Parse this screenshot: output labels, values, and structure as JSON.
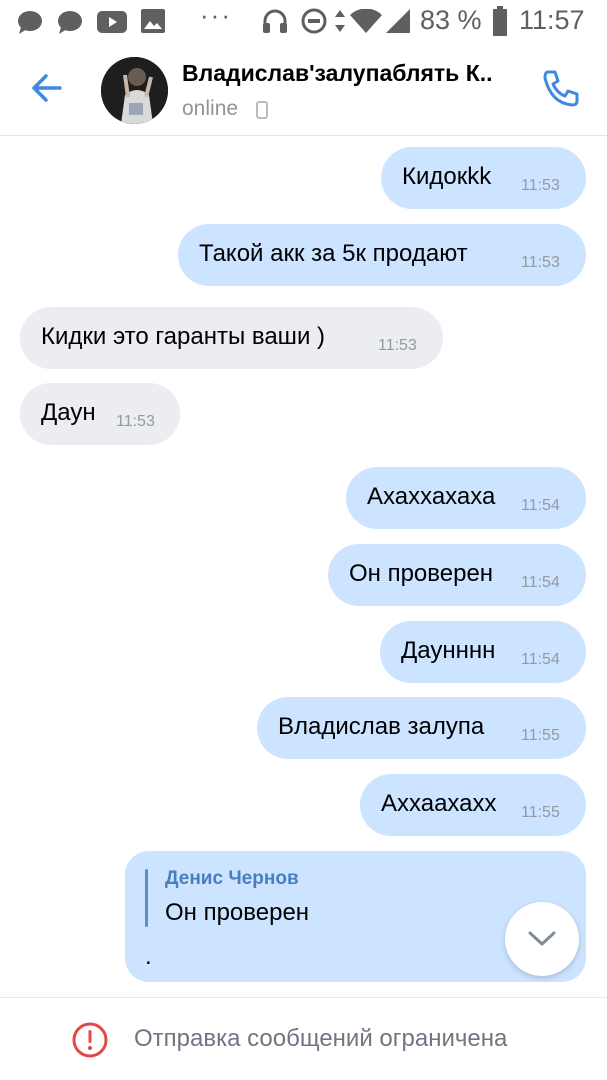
{
  "status_bar": {
    "dots": "···",
    "battery_percent": "83 %",
    "time": "11:57",
    "icons": [
      "chat-bubble-icon",
      "chat-bubble-icon",
      "youtube-icon",
      "image-icon",
      "headphones-icon",
      "dnd-icon",
      "data-arrows-icon",
      "wifi-icon",
      "signal-icon",
      "battery-icon"
    ]
  },
  "header": {
    "contact_name": "Владислав'залупаблять К..",
    "status": "online"
  },
  "messages": [
    {
      "text": "Кидокkk",
      "time": "11:53",
      "direction": "out"
    },
    {
      "text": "Такой акк за 5к продают",
      "time": "11:53",
      "direction": "out"
    },
    {
      "text": "Кидки это гаранты ваши )",
      "time": "11:53",
      "direction": "in"
    },
    {
      "text": "Даун",
      "time": "11:53",
      "direction": "in"
    },
    {
      "text": "Ахаххахаха",
      "time": "11:54",
      "direction": "out"
    },
    {
      "text": "Он проверен",
      "time": "11:54",
      "direction": "out"
    },
    {
      "text": "Даунннн",
      "time": "11:54",
      "direction": "out"
    },
    {
      "text": "Владислав залупа",
      "time": "11:55",
      "direction": "out"
    },
    {
      "text": "Аххаахахх",
      "time": "11:55",
      "direction": "out"
    }
  ],
  "reply_message": {
    "quoted_author": "Денис Чернов",
    "quoted_text": "Он проверен",
    "body": "."
  },
  "footer": {
    "notice": "Отправка сообщений ограничена"
  },
  "colors": {
    "accent": "#3f8ae0",
    "outgoing_bubble": "#cce4ff",
    "incoming_bubble": "#ebedf0",
    "warning": "#e64646"
  }
}
